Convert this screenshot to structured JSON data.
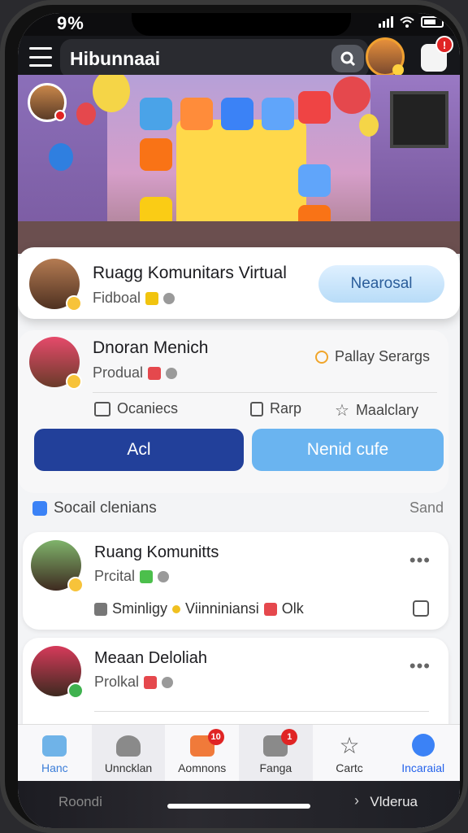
{
  "status": {
    "time": "9%"
  },
  "header": {
    "title": "Hibunnaai"
  },
  "hero": {
    "description_icons": [
      "party-balloons",
      "kid-presenting",
      "video-tiles"
    ]
  },
  "card_featured": {
    "title": "Ruagg Komunitars Virtual",
    "subtitle": "Fidboal",
    "button": "Nearosal"
  },
  "card_profile": {
    "title": "Dnoran Menich",
    "subtitle": "Produal",
    "option": "Pallay Serargs",
    "actions": [
      "Ocaniecs",
      "Rarp",
      "Maalclary"
    ],
    "btn_primary": "Acl",
    "btn_secondary": "Nenid cufe"
  },
  "section": {
    "title": "Socail clenians",
    "more": "Sand"
  },
  "feed": [
    {
      "title": "Ruang Komunitts",
      "subtitle": "Prcital",
      "meta1": "Sminligy",
      "meta2": "Viinniniansi",
      "meta3": "Olk"
    },
    {
      "title": "Meaan Deloliah",
      "subtitle": "Prolkal"
    }
  ],
  "tabs": [
    {
      "label": "Hanc"
    },
    {
      "label": "Unncklan"
    },
    {
      "label": "Aomnons",
      "badge": "10"
    },
    {
      "label": "Fanga",
      "badge": "1"
    },
    {
      "label": "Cartc"
    },
    {
      "label": "Incaraial"
    }
  ],
  "bottom": {
    "left": "Roondi",
    "right": "Vlderua"
  },
  "colors": {
    "primary": "#22409a",
    "accent": "#6ab4f0",
    "badge": "#e02424"
  }
}
